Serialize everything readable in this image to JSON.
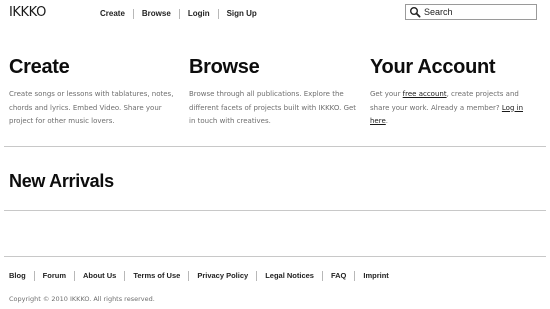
{
  "header": {
    "logo": "IKKKO",
    "nav": [
      {
        "label": "Create"
      },
      {
        "label": "Browse"
      },
      {
        "label": "Login"
      },
      {
        "label": "Sign Up"
      }
    ],
    "search": {
      "placeholder": "Search",
      "value": "",
      "icon": "magnifier-icon"
    }
  },
  "features": {
    "create": {
      "title": "Create",
      "text": "Create songs or lessons with tablatures, notes, chords and lyrics. Embed Video. Share your project for other music lovers."
    },
    "browse": {
      "title": "Browse",
      "text": "Browse through all publications. Explore the different facets of projects built with IKKKO. Get in touch with creatives."
    },
    "account": {
      "title": "Your Account",
      "text_before_link": "Get your ",
      "link_free_account": "free account",
      "text_middle": ", create projects and share your work. Already a member? ",
      "link_login": "Log in here",
      "text_after": "."
    }
  },
  "new_arrivals": {
    "title": "New Arrivals"
  },
  "footer": {
    "links": [
      {
        "label": "Blog"
      },
      {
        "label": "Forum"
      },
      {
        "label": "About Us"
      },
      {
        "label": "Terms of Use"
      },
      {
        "label": "Privacy Policy"
      },
      {
        "label": "Legal Notices"
      },
      {
        "label": "FAQ"
      },
      {
        "label": "Imprint"
      }
    ],
    "copyright": "Copyright © 2010 IKKKO. All rights reserved."
  },
  "colors": {
    "background": "#ffffff",
    "heading": "#0d0d0d",
    "body_text": "#6e6e6e",
    "divider": "#c8c8c8"
  }
}
